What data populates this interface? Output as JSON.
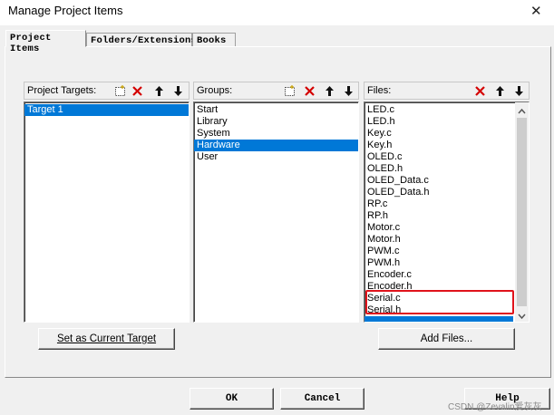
{
  "window": {
    "title": "Manage Project Items",
    "close_glyph": "✕"
  },
  "tabs": [
    {
      "label": "Project Items",
      "active": true
    },
    {
      "label": "Folders/Extensions",
      "active": false
    },
    {
      "label": "Books",
      "active": false
    }
  ],
  "targets": {
    "label": "Project Targets:",
    "items": [
      "Target 1"
    ],
    "selected": "Target 1",
    "button": "Set as Current Target",
    "tools": [
      "new-icon",
      "delete-icon",
      "move-up-icon",
      "move-down-icon"
    ]
  },
  "groups": {
    "label": "Groups:",
    "items": [
      "Start",
      "Library",
      "System",
      "Hardware",
      "User"
    ],
    "selected": "Hardware",
    "tools": [
      "new-icon",
      "delete-icon",
      "move-up-icon",
      "move-down-icon"
    ]
  },
  "files": {
    "label": "Files:",
    "items": [
      "LED.c",
      "LED.h",
      "Key.c",
      "Key.h",
      "OLED.c",
      "OLED.h",
      "OLED_Data.c",
      "OLED_Data.h",
      "RP.c",
      "RP.h",
      "Motor.c",
      "Motor.h",
      "PWM.c",
      "PWM.h",
      "Encoder.c",
      "Encoder.h",
      "Serial.c",
      "Serial.h"
    ],
    "highlighted": [
      "Serial.c",
      "Serial.h"
    ],
    "button": "Add Files...",
    "tools": [
      "delete-icon",
      "move-up-icon",
      "move-down-icon"
    ]
  },
  "footer": {
    "ok": "OK",
    "cancel": "Cancel",
    "help": "Help"
  },
  "watermark": "CSDN @Zevalin爱灰灰",
  "colors": {
    "selection": "#0078d7",
    "delete_red": "#d40000",
    "highlight_box": "#e0131b"
  }
}
